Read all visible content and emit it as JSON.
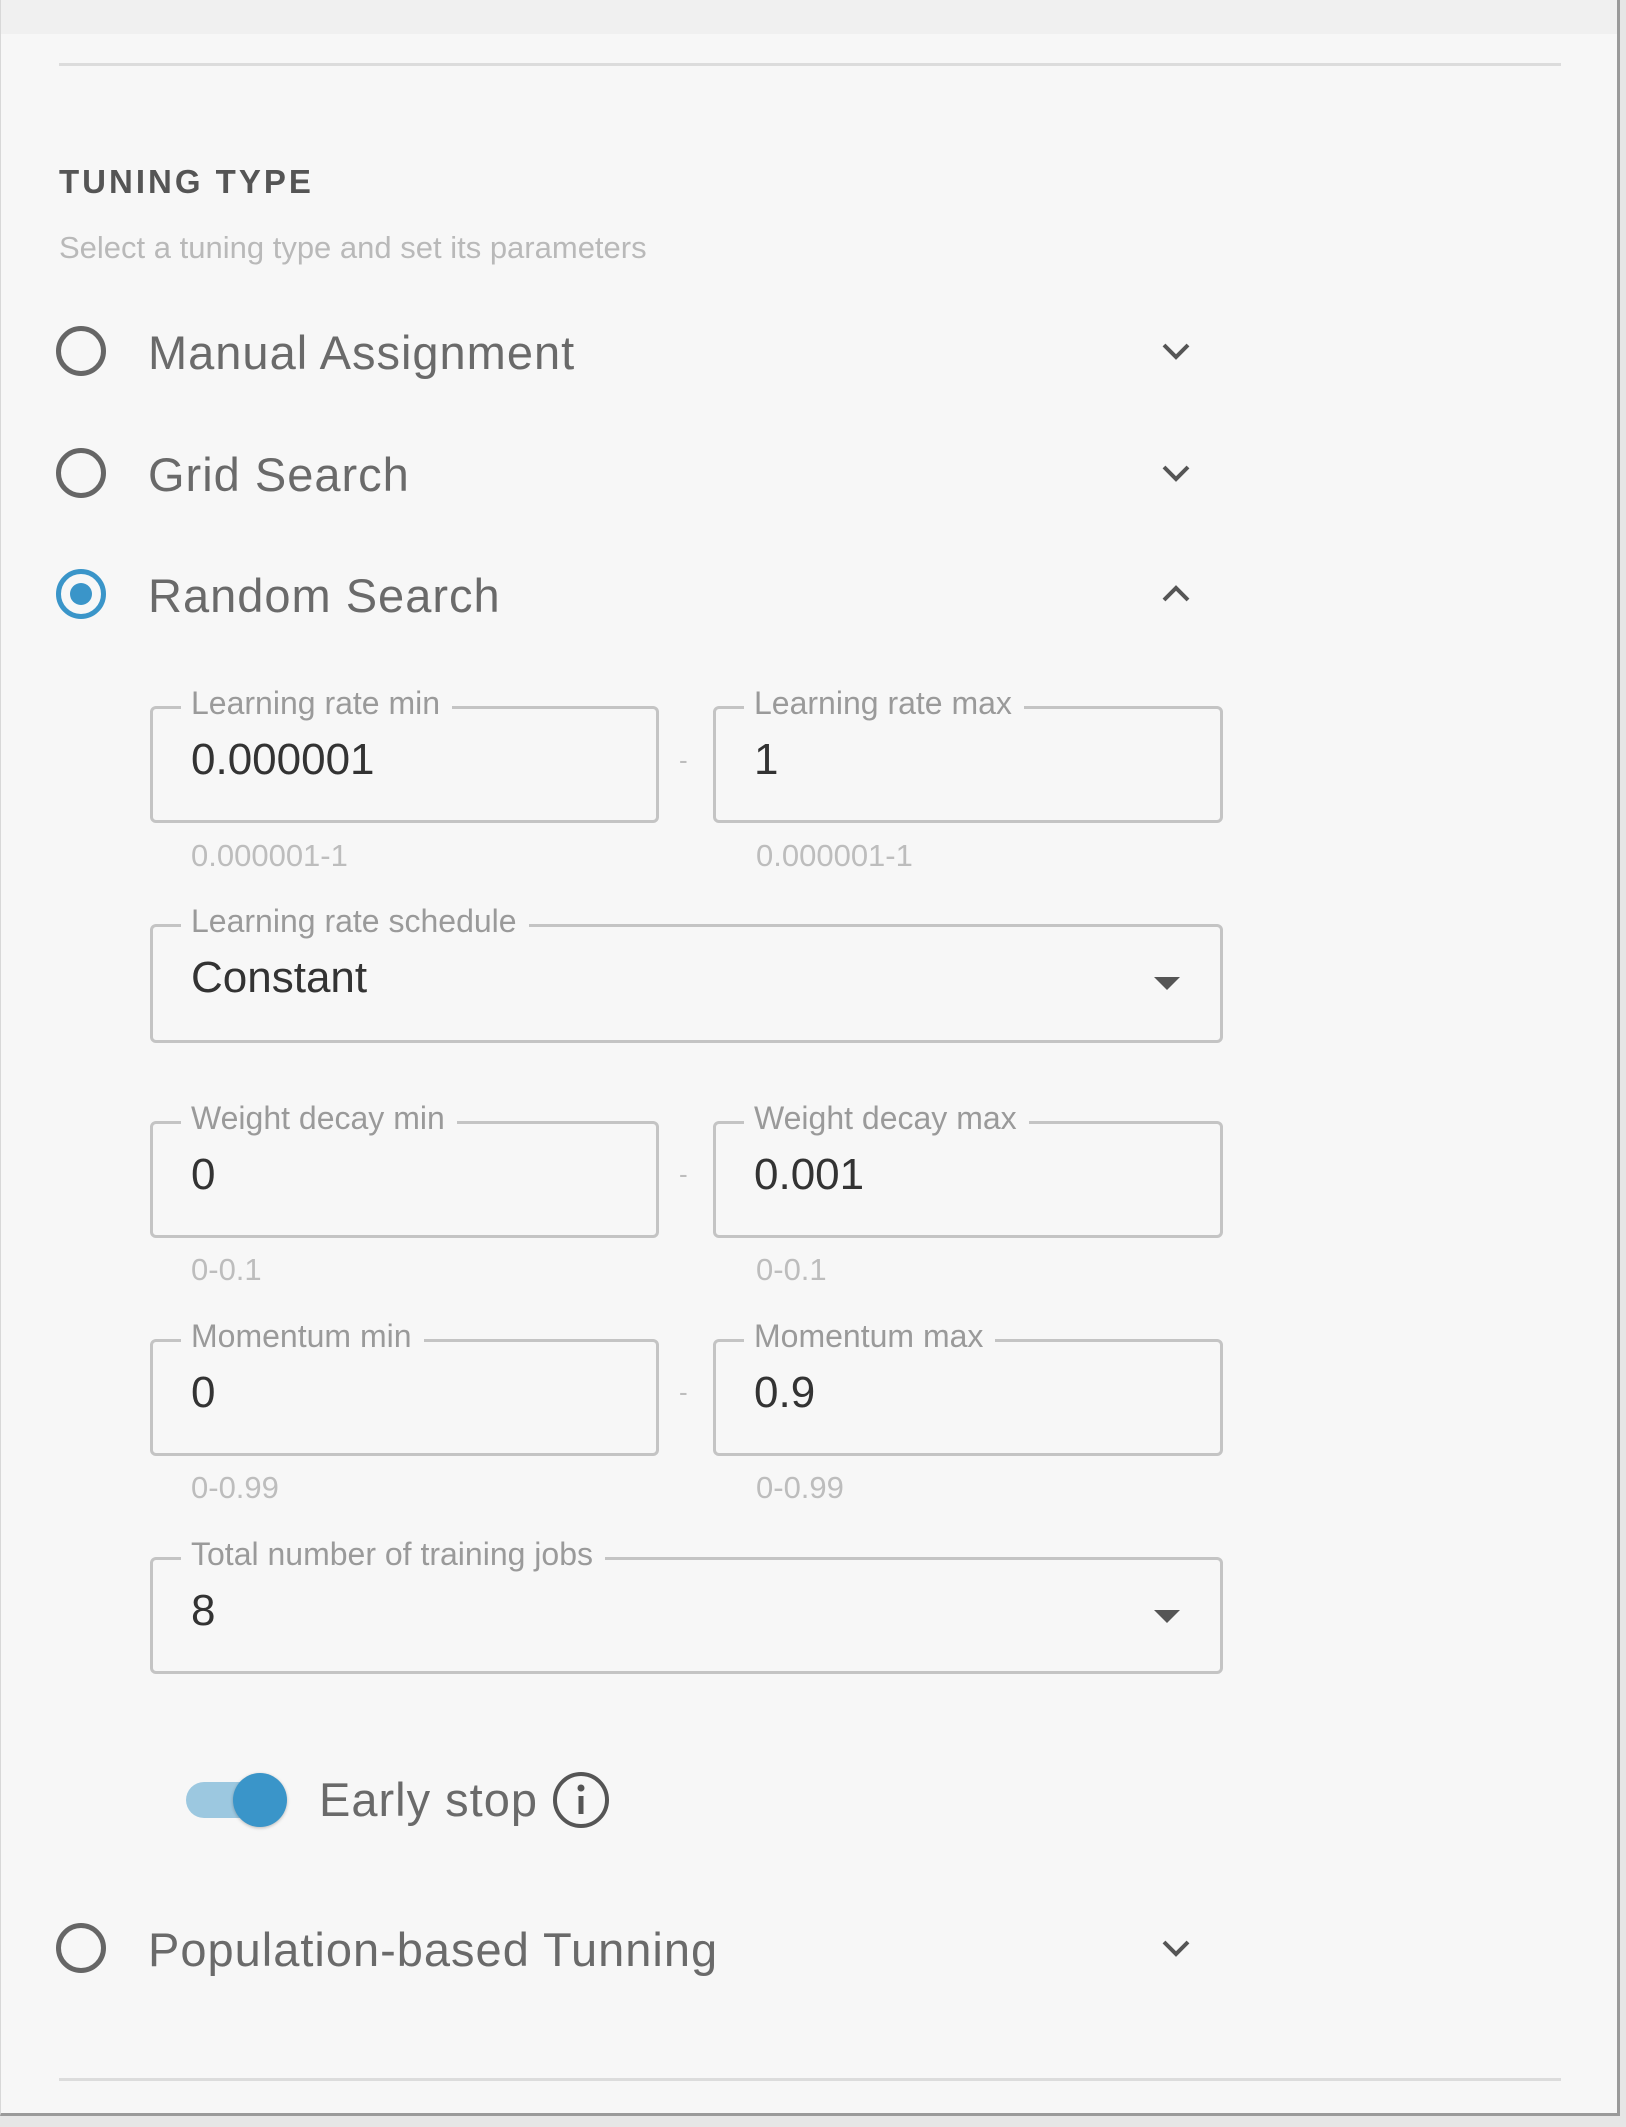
{
  "section": {
    "title": "TUNING TYPE",
    "subtitle": "Select a tuning type and set its parameters"
  },
  "options": [
    {
      "label": "Manual Assignment",
      "selected": false,
      "expanded": false,
      "icon": "chevron-down-icon"
    },
    {
      "label": "Grid Search",
      "selected": false,
      "expanded": false,
      "icon": "chevron-down-icon"
    },
    {
      "label": "Random Search",
      "selected": true,
      "expanded": true,
      "icon": "chevron-up-icon"
    },
    {
      "label": "Population-based Tunning",
      "selected": false,
      "expanded": false,
      "icon": "chevron-down-icon"
    }
  ],
  "random_search": {
    "learning_rate_min": {
      "label": "Learning rate min",
      "value": "0.000001",
      "helper": "0.000001-1"
    },
    "learning_rate_max": {
      "label": "Learning rate max",
      "value": "1",
      "helper": "0.000001-1"
    },
    "learning_rate_separator": "-",
    "learning_rate_schedule": {
      "label": "Learning rate schedule",
      "value": "Constant"
    },
    "weight_decay_min": {
      "label": "Weight decay min",
      "value": "0",
      "helper": "0-0.1"
    },
    "weight_decay_max": {
      "label": "Weight decay max",
      "value": "0.001",
      "helper": "0-0.1"
    },
    "weight_decay_separator": "-",
    "momentum_min": {
      "label": "Momentum min",
      "value": "0",
      "helper": "0-0.99"
    },
    "momentum_max": {
      "label": "Momentum max",
      "value": "0.9",
      "helper": "0-0.99"
    },
    "momentum_separator": "-",
    "total_training_jobs": {
      "label": "Total number of training jobs",
      "value": "8"
    },
    "early_stop": {
      "label": "Early stop",
      "enabled": true,
      "icon": "info-icon"
    }
  },
  "colors": {
    "accent": "#3a95c9",
    "accent_light": "#9cc8e0",
    "text": "#6a6a6a",
    "helper": "#bdbdbd"
  }
}
